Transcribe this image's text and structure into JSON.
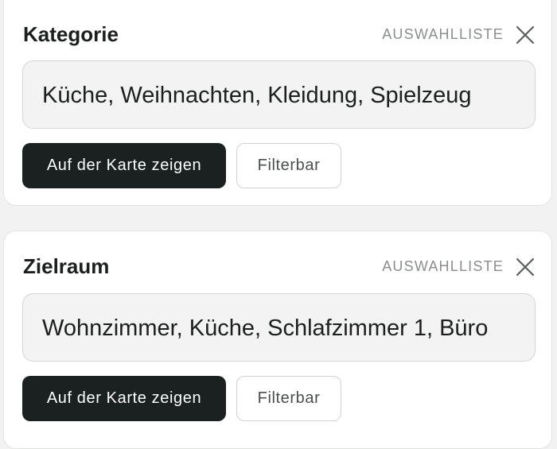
{
  "filters": [
    {
      "title": "Kategorie",
      "type_label": "AUSWAHLLISTE",
      "close_icon": "close-icon",
      "value": "Küche, Weihnachten, Kleidung, Spielzeug",
      "primary_button": "Auf der Karte zeigen",
      "secondary_button": "Filterbar"
    },
    {
      "title": "Zielraum",
      "type_label": "AUSWAHLLISTE",
      "close_icon": "close-icon",
      "value": "Wohnzimmer, Küche, Schlafzimmer 1, Büro",
      "primary_button": "Auf der Karte zeigen",
      "secondary_button": "Filterbar"
    }
  ],
  "colors": {
    "page_background": "#f1f2f1",
    "card_background": "#ffffff",
    "primary_button": "#1b2120",
    "muted_text": "#8a8f8d"
  }
}
